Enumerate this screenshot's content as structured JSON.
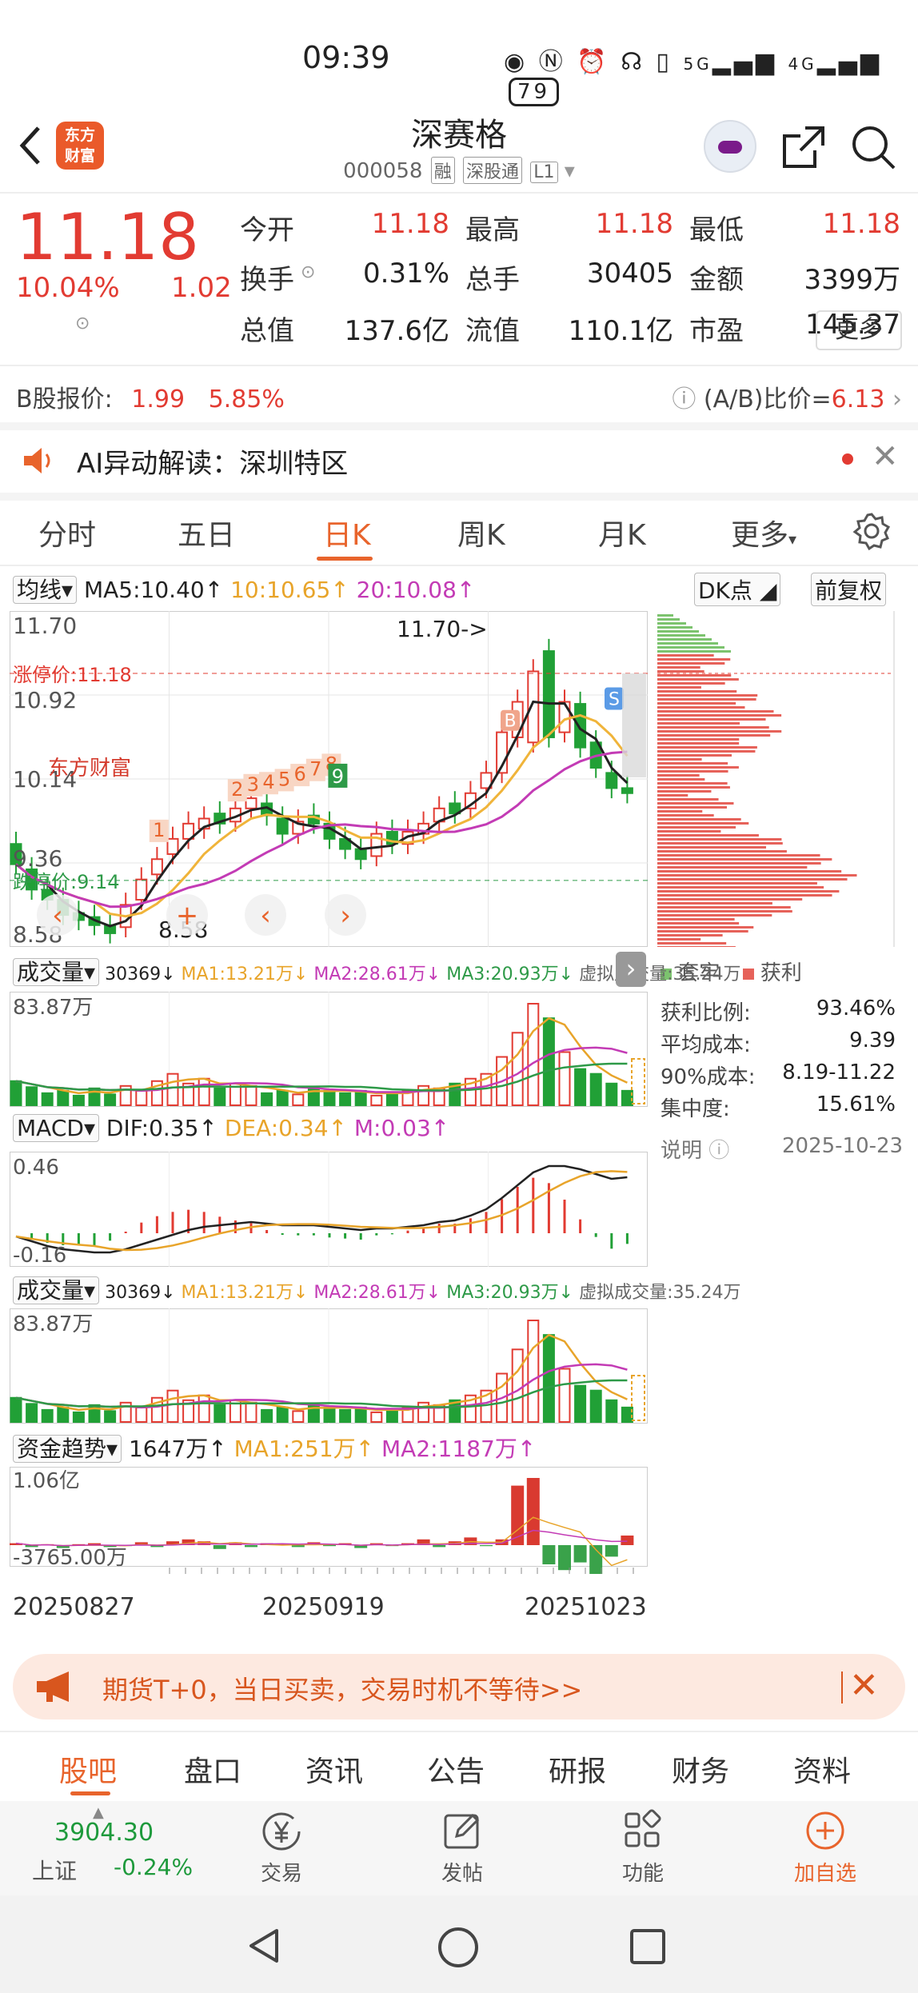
{
  "status": {
    "time": "09:39",
    "net1": "5G",
    "net2": "4G",
    "battery": "79"
  },
  "header": {
    "logo": "东方财富",
    "name": "深赛格",
    "code": "000058",
    "tag1": "融",
    "tag2": "深股通",
    "tag3": "L1"
  },
  "quote": {
    "price": "11.18",
    "pct": "10.04%",
    "chg": "1.02",
    "rows": [
      [
        {
          "label": "今开",
          "value": "11.18",
          "color": "#e23b32"
        },
        {
          "label": "最高",
          "value": "11.18",
          "color": "#e23b32"
        },
        {
          "label": "最低",
          "value": "11.18",
          "color": "#e23b32"
        }
      ],
      [
        {
          "label": "换手",
          "value": "0.31%",
          "color": "#222"
        },
        {
          "label": "总手",
          "value": "30405",
          "color": "#222"
        },
        {
          "label": "金额",
          "value": "3399万",
          "color": "#222"
        }
      ],
      [
        {
          "label": "总值",
          "value": "137.6亿",
          "color": "#222"
        },
        {
          "label": "流值",
          "value": "110.1亿",
          "color": "#222"
        },
        {
          "label": "市盈",
          "value": "145.37",
          "color": "#222"
        }
      ]
    ],
    "more": "更多"
  },
  "bshare": {
    "label": "B股报价:",
    "price": "1.99",
    "pct": "5.85%",
    "ratio_label": "(A/B)比价=",
    "ratio": "6.13"
  },
  "ai": {
    "text": "AI异动解读：深圳特区"
  },
  "tabs": {
    "t1": "分时",
    "t2": "五日",
    "t3": "日K",
    "t4": "周K",
    "t5": "月K",
    "t6": "更多"
  },
  "kline": {
    "ma_select": "均线",
    "ma5": "MA5:10.40↑",
    "ma10": "10:10.65↑",
    "ma20": "20:10.08↑",
    "dk": "DK点",
    "adjust": "前复权",
    "y_high": "11.70",
    "y_2": "10.92",
    "y_3": "10.14",
    "y_4": "9.36",
    "y_low": "8.58",
    "limit_label": "涨停价:11.18",
    "floor_label": "跌停价:9.14",
    "max_note": "11.70->",
    "min_note": "8.58",
    "signal_b": "B",
    "signal_s": "S",
    "nine_labels": [
      "1",
      "2",
      "3",
      "4",
      "5",
      "6",
      "7",
      "8",
      "9"
    ],
    "watermark": "东方财富",
    "colors": {
      "up": "#e23b32",
      "down": "#21a036",
      "ma5": "#222222",
      "ma10": "#f0b43a",
      "ma20": "#c33bb5"
    }
  },
  "chip": {
    "legend_trap": "套牢",
    "legend_profit": "获利",
    "stats": [
      {
        "label": "获利比例:",
        "value": "93.46%"
      },
      {
        "label": "平均成本:",
        "value": "9.39"
      },
      {
        "label": "90%成本:",
        "value": "8.19-11.22"
      },
      {
        "label": "集中度:",
        "value": "15.61%"
      }
    ],
    "note_label": "说明",
    "date": "2025-10-23"
  },
  "volume": {
    "select": "成交量",
    "v": "30369↓",
    "ma1": "MA1:13.21万↓",
    "ma2": "MA2:28.61万↓",
    "ma3": "MA3:20.93万↓",
    "virtual": "虚拟成交量:35.24万",
    "max": "83.87万"
  },
  "macd": {
    "select": "MACD",
    "dif": "DIF:0.35↑",
    "dea": "DEA:0.34↑",
    "m": "M:0.03↑",
    "top": "0.46",
    "bottom": "-0.16"
  },
  "volume2": {
    "select": "成交量",
    "v": "30369↓",
    "ma1": "MA1:13.21万↓",
    "ma2": "MA2:28.61万↓",
    "ma3": "MA3:20.93万↓",
    "virtual": "虚拟成交量:35.24万",
    "max": "83.87万"
  },
  "fund": {
    "select": "资金趋势",
    "v": "1647万↑",
    "ma1": "MA1:251万↑",
    "ma2": "MA2:1187万↑",
    "top": "1.06亿",
    "bottom": "-3765.00万"
  },
  "dates": {
    "d1": "20250827",
    "d2": "20250919",
    "d3": "20251023"
  },
  "banner": {
    "text": "期货T+0，当日买卖，交易时机不等待>>"
  },
  "bottom_tabs": [
    "股吧",
    "盘口",
    "资讯",
    "公告",
    "研报",
    "财务",
    "资料"
  ],
  "index": {
    "value": "3904.30",
    "name": "上证",
    "pct": "-0.24%"
  },
  "toolbar": [
    {
      "label": "交易",
      "icon": "yen-icon"
    },
    {
      "label": "发帖",
      "icon": "edit-icon"
    },
    {
      "label": "功能",
      "icon": "grid-icon"
    },
    {
      "label": "加自选",
      "icon": "add-icon"
    }
  ]
}
